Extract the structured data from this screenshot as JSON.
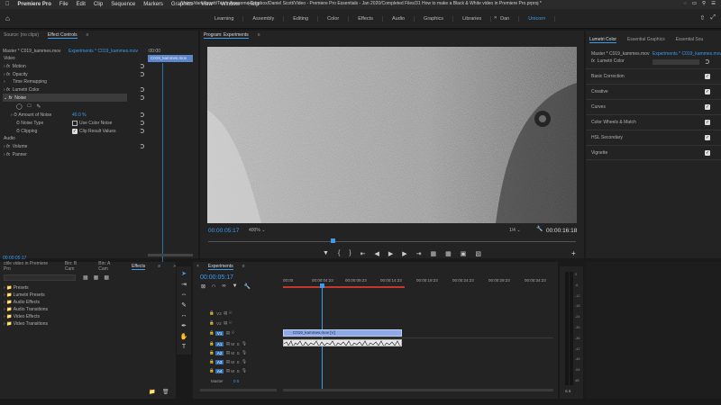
{
  "menubar": {
    "items": [
      "Premiere Pro",
      "File",
      "Edit",
      "Clip",
      "Sequence",
      "Markers",
      "Graphics",
      "View",
      "Window",
      "Help"
    ],
    "path": "/Users/danielscott/Team Awesome Dropbox/Daniel Scott/Video - Premiere Pro Essentials - Jan 2020/Completed Files/31 How to make a Black & White video in Premiere Pro.prproj *"
  },
  "workspace": {
    "tabs": [
      "Learning",
      "Assembly",
      "Editing",
      "Color",
      "Effects",
      "Audio",
      "Graphics",
      "Libraries",
      "Dan",
      "Unicorn"
    ],
    "active": "Unicorn"
  },
  "effect_controls": {
    "tabs": [
      "Source: (no clips)",
      "Effect Controls"
    ],
    "master_label": "Master * C019_kammes.mov",
    "sequence_label": "Experiments * C019_kammes.mov",
    "timeline_time": ":00:00",
    "clip_label": "C019_kammes.mov",
    "video_header": "Video",
    "effects": [
      "Motion",
      "Opacity",
      "Time Remapping",
      "Lumetri Color",
      "Noise"
    ],
    "noise_props": {
      "amount_label": "Amount of Noise",
      "amount_value": "40.0 %",
      "type_label": "Noise Type",
      "type_value": "Use Color Noise",
      "clipping_label": "Clipping",
      "clipping_value": "Clip Result Values"
    },
    "audio_header": "Audio",
    "audio_effects": [
      "Volume",
      "Panner"
    ],
    "timecode": "00:00:05:17"
  },
  "program": {
    "title": "Program: Experiments",
    "timecode": "00:00:05:17",
    "zoom": "400%",
    "quality": "1/4",
    "duration": "00:00:16:18"
  },
  "lumetri": {
    "tabs": [
      "Lumetri Color",
      "Essential Graphics",
      "Essential Sou"
    ],
    "master_label": "Master * C019_kammes.mov",
    "sequence_label": "Experiments * C019_kammes.mov",
    "fx_label": "Lumetri Color",
    "sections": [
      "Basic Correction",
      "Creative",
      "Curves",
      "Color Wheels & Match",
      "HSL Secondary",
      "Vignette"
    ]
  },
  "project": {
    "tabs": [
      "ctile video in Premiere Pro",
      "Bin: B Cam",
      "Bin: A Cam",
      "Effects"
    ],
    "items": [
      "Presets",
      "Lumetri Presets",
      "Audio Effects",
      "Audio Transitions",
      "Video Effects",
      "Video Transitions"
    ]
  },
  "timeline": {
    "tab": "Experiments",
    "timecode": "00:00:05:17",
    "ruler": [
      "00:00",
      "00:00:04:23",
      "00:00:09:23",
      "00:00:14:23",
      "00:00:19:23",
      "00:00:24:23",
      "00:00:29:23",
      "00:00:34:23"
    ],
    "video_tracks": [
      "V3",
      "V2",
      "V1"
    ],
    "audio_tracks": [
      "A1",
      "A2",
      "A3",
      "A4"
    ],
    "master_label": "Master",
    "master_value": "0.0",
    "clip_label": "C019_kammes.mov [V]"
  },
  "meter": {
    "scale": [
      "0",
      "-6",
      "-12",
      "-18",
      "-24",
      "-30",
      "-36",
      "-42",
      "-48",
      "-54",
      "dB"
    ]
  },
  "colors": {
    "accent": "#3a9cf0",
    "clip_video": "#8ea9e6",
    "panel": "#232323"
  }
}
